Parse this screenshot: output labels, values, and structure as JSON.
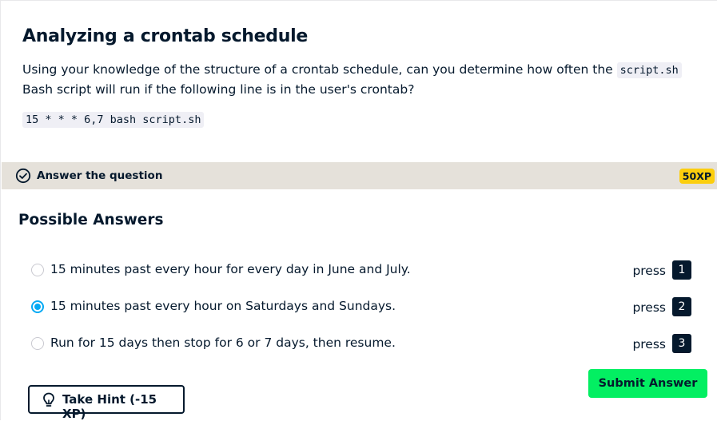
{
  "exercise": {
    "title": "Analyzing a crontab schedule",
    "description_parts": [
      "Using your knowledge of the structure of a crontab schedule, can you determine how often the ",
      "script.sh",
      " Bash script will run if the following line is in the user's crontab?"
    ],
    "code_line": "15 * * * 6,7 bash script.sh"
  },
  "question_bar": {
    "label": "Answer the question",
    "xp_badge": "50XP",
    "icon": "check-circle-icon"
  },
  "answers_section": {
    "title": "Possible Answers",
    "selected_index": 1,
    "options": [
      {
        "text": "15 minutes past every hour for every day in June and July.",
        "press_label": "press",
        "key": "1"
      },
      {
        "text": "15 minutes past every hour on Saturdays and Sundays.",
        "press_label": "press",
        "key": "2"
      },
      {
        "text": "Run for 15 days then stop for 6 or 7 days, then resume.",
        "press_label": "press",
        "key": "3"
      }
    ]
  },
  "actions": {
    "submit_label": "Submit Answer",
    "hint_label": "Take Hint (-15 XP)",
    "hint_icon": "lightbulb-icon"
  },
  "colors": {
    "text": "#05192d",
    "question_bar": "#e5e1da",
    "xp_badge": "#fcce0d",
    "submit_green": "#03ef62",
    "radio_selected": "#03a9f4",
    "code_bg": "#efeff5"
  }
}
